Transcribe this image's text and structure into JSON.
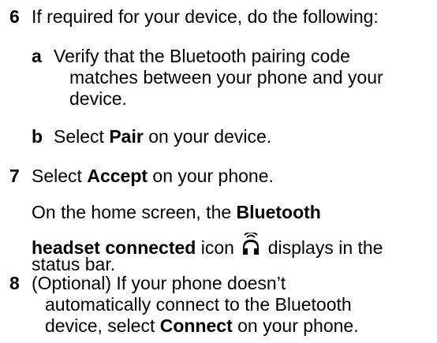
{
  "steps": {
    "s6": {
      "number": "6",
      "text": "If required for your device, do the following:",
      "a": {
        "letter": "a",
        "line1": "Verify that the Bluetooth pairing code",
        "line2": "matches between your phone and your",
        "line3": "device."
      },
      "b": {
        "letter": "b",
        "pre": "Select ",
        "bold": "Pair",
        "post": " on your device."
      }
    },
    "s7": {
      "number": "7",
      "pre": "Select ",
      "bold": "Accept",
      "post": " on your phone.",
      "note": {
        "line1_pre": "On the home screen, the ",
        "line1_bold": "Bluetooth",
        "line2_bold": "headset connected",
        "line2_mid": " icon ",
        "icon": "bluetooth-headset-connected-icon",
        "line2_post": " displays in the",
        "line3": "status bar."
      }
    },
    "s8": {
      "number": "8",
      "line1": "(Optional) If your phone doesn’t",
      "line2": "automatically connect to the Bluetooth",
      "line3_pre": "device, select ",
      "line3_bold": "Connect",
      "line3_post": " on your phone."
    }
  }
}
